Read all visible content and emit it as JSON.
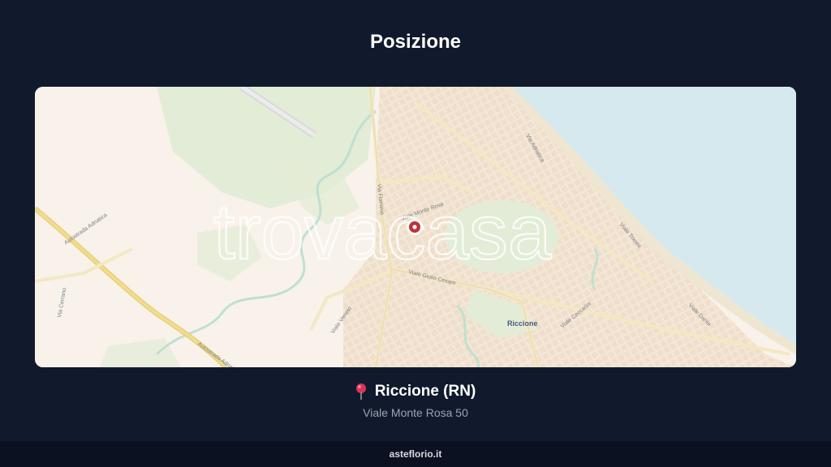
{
  "header": {
    "title": "Posizione"
  },
  "map": {
    "watermark": "trovacasa",
    "town_label": "Riccione",
    "street_labels": {
      "giulio_cesare": "Viale Giulio Cesare",
      "flaminio": "Via Flaminia",
      "monte_rosa": "Viale Monte Rosa",
      "veneto": "Viale Veneto",
      "autostrada": "Autostrada Adriatica",
      "autostrada2": "Autostrada Adriatica",
      "ceccarini": "Viale Ceccarini",
      "cerrano": "Via Cerrano",
      "adriatica": "Via Adriatica",
      "dante": "Viale Dante",
      "trieste": "Viale Trieste"
    },
    "colors": {
      "land": "#f8f2ea",
      "sea": "#d6e9ee",
      "park": "#e3ecd6",
      "highway": "#f0dc8e",
      "road": "#f4e8c2",
      "marker": "#c0313b"
    }
  },
  "location": {
    "pin_icon": "round-pushpin",
    "city": "Riccione (RN)",
    "address": "Viale Monte Rosa 50"
  },
  "footer": {
    "site": "asteflorio.it"
  }
}
